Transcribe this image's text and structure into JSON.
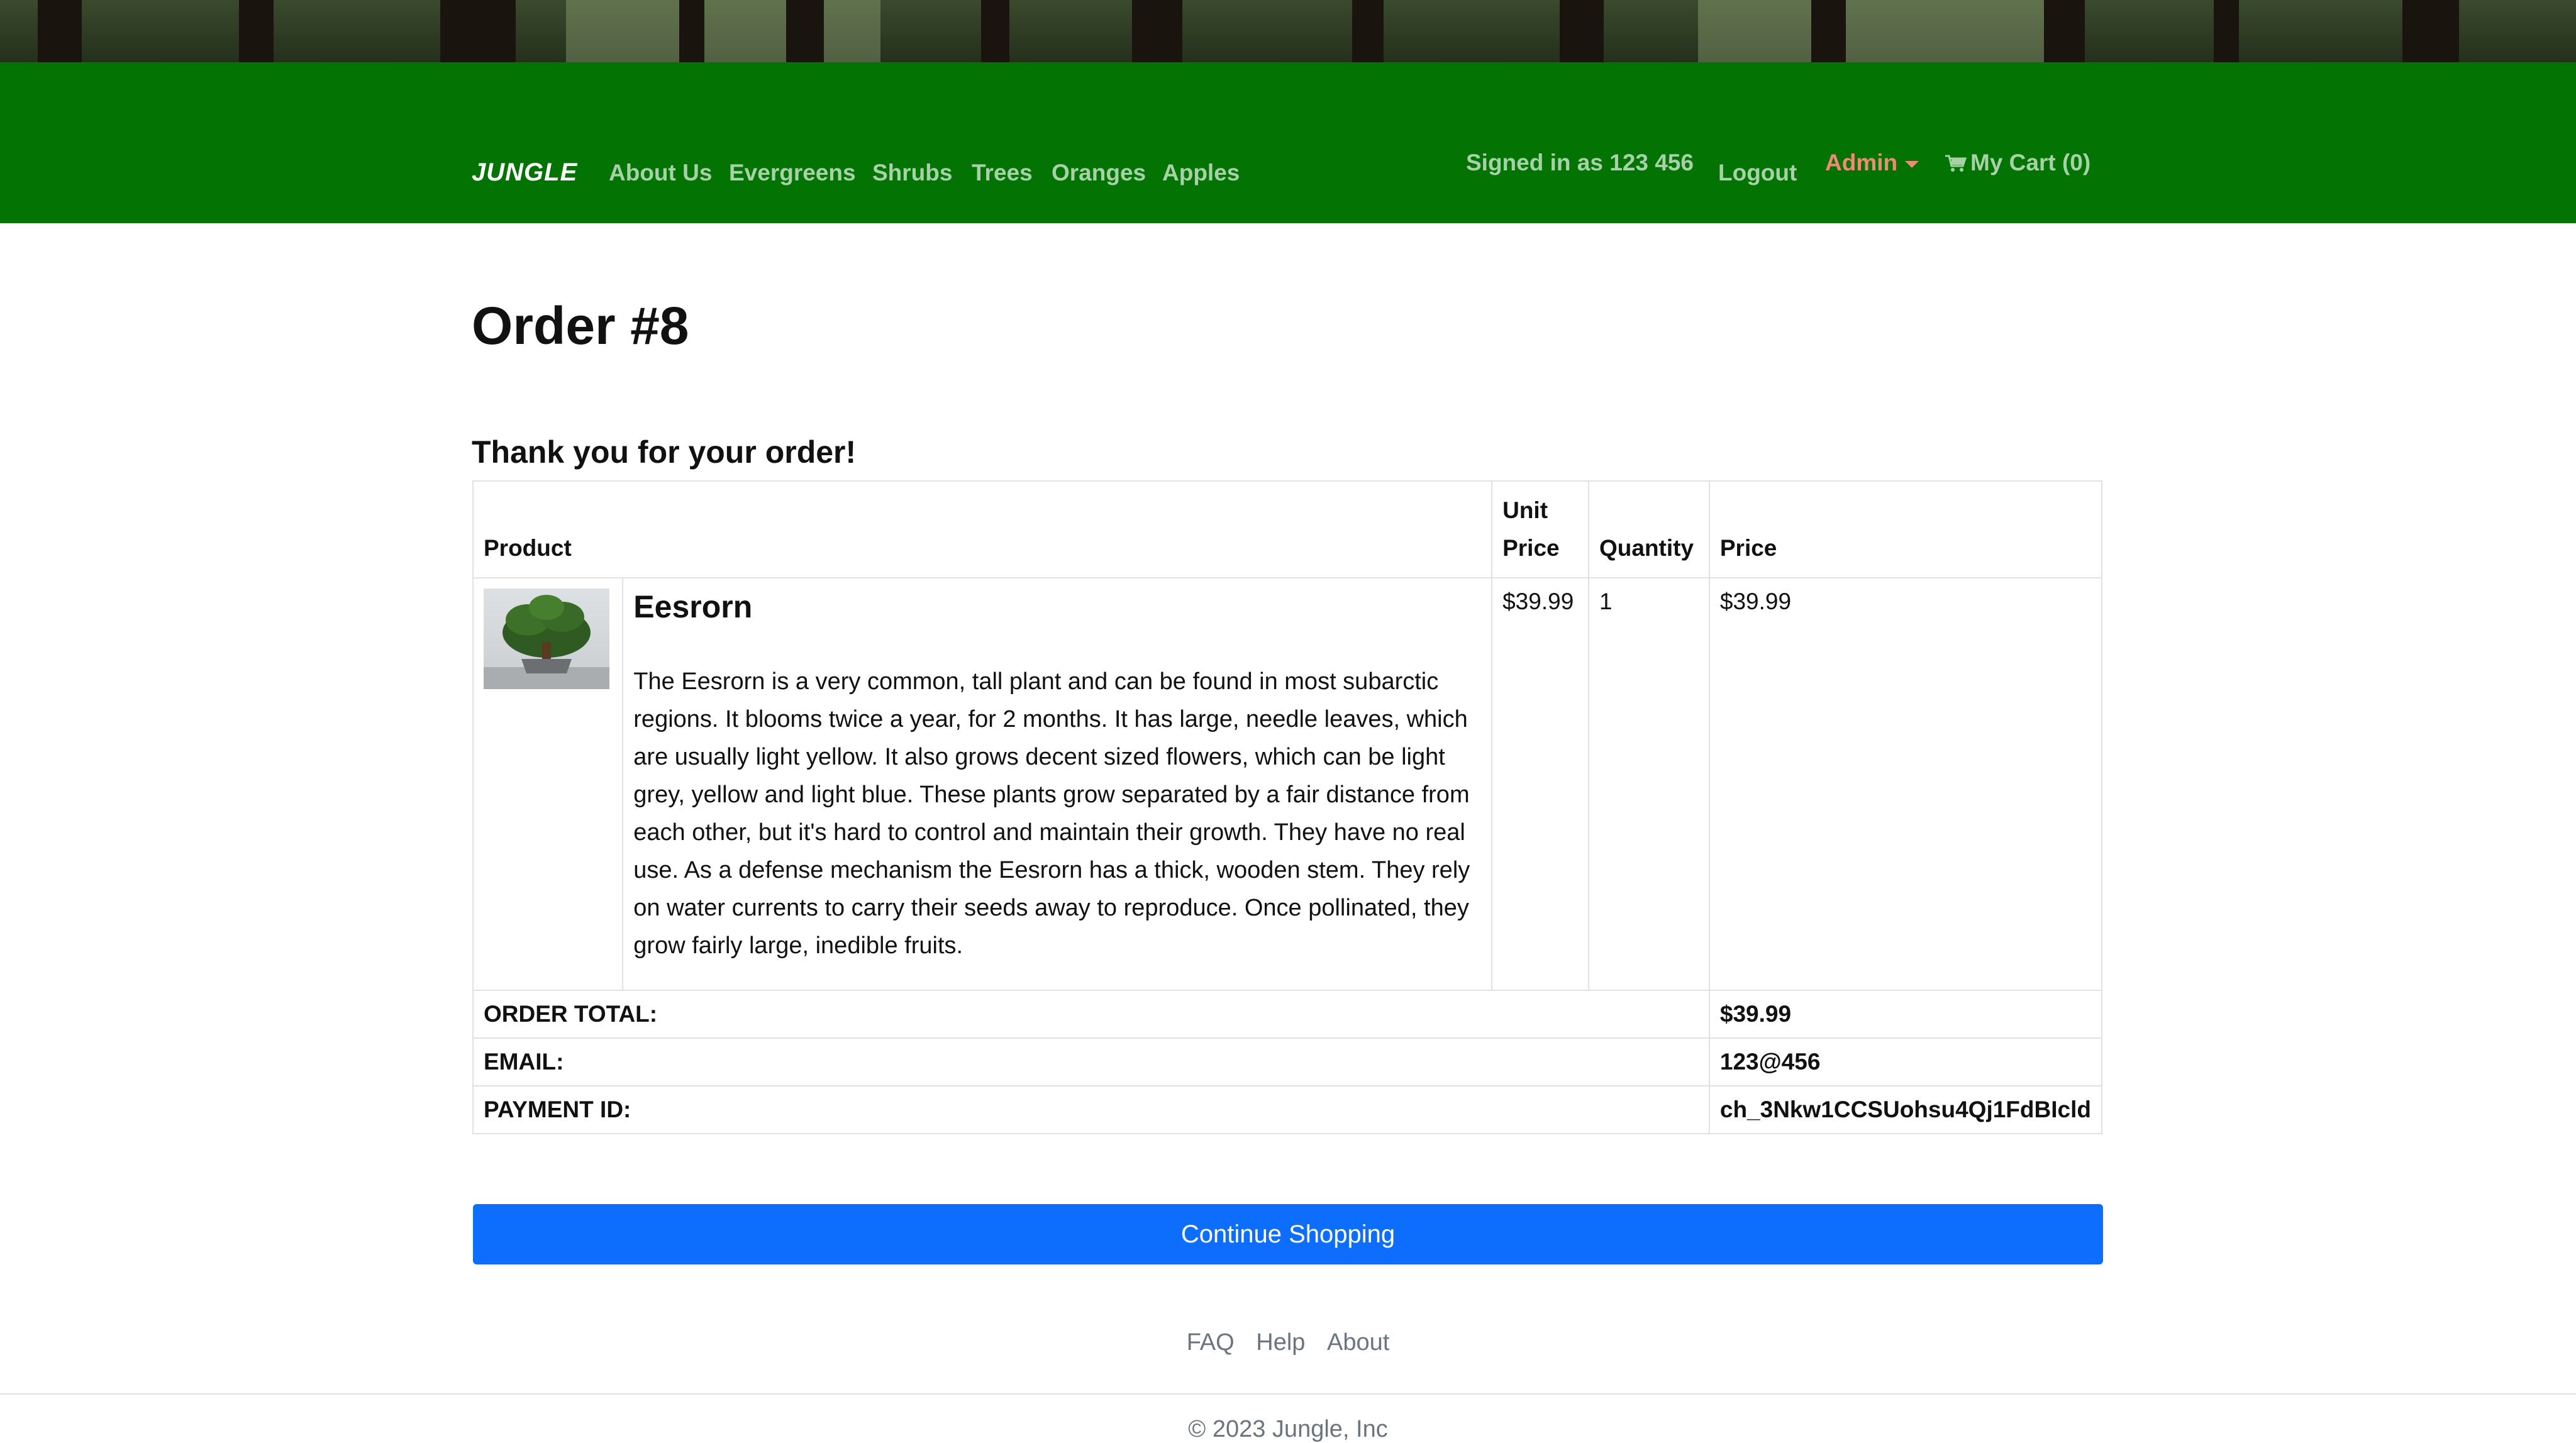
{
  "nav": {
    "brand": "JUNGLE",
    "links": [
      "About Us",
      "Evergreens",
      "Shrubs",
      "Trees",
      "Oranges",
      "Apples"
    ],
    "signed_in": "Signed in as 123 456",
    "logout": "Logout",
    "admin": "Admin",
    "cart": "My Cart (0)",
    "cart_icon": "shopping-cart-icon"
  },
  "colors": {
    "navbar": "#037303",
    "nav_link": "#a7d2a7",
    "admin": "#ee8a76",
    "primary_button": "#0d6efd"
  },
  "order": {
    "title": "Order #8",
    "thanks": "Thank you for your order!",
    "columns": {
      "product": "Product",
      "unit_price_line1": "Unit",
      "unit_price_line2": "Price",
      "quantity": "Quantity",
      "price": "Price"
    },
    "item": {
      "name": "Eesrorn",
      "description": "The Eesrorn is a very common, tall plant and can be found in most subarctic regions. It blooms twice a year, for 2 months. It has large, needle leaves, which are usually light yellow. It also grows decent sized flowers, which can be light grey, yellow and light blue. These plants grow separated by a fair distance from each other, but it's hard to control and maintain their growth. They have no real use. As a defense mechanism the Eesrorn has a thick, wooden stem. They rely on water currents to carry their seeds away to reproduce. Once pollinated, they grow fairly large, inedible fruits.",
      "unit_price": "$39.99",
      "quantity": "1",
      "price": "$39.99",
      "image": "bonsai-tree-image"
    },
    "total_label": "ORDER TOTAL:",
    "total_value": "$39.99",
    "email_label": "EMAIL:",
    "email_value": "123@456",
    "payment_label": "PAYMENT ID:",
    "payment_value": "ch_3Nkw1CCSUohsu4Qj1FdBIcld"
  },
  "continue_button": "Continue Shopping",
  "footer": {
    "links": [
      "FAQ",
      "Help",
      "About"
    ],
    "copyright": "© 2023 Jungle, Inc"
  }
}
